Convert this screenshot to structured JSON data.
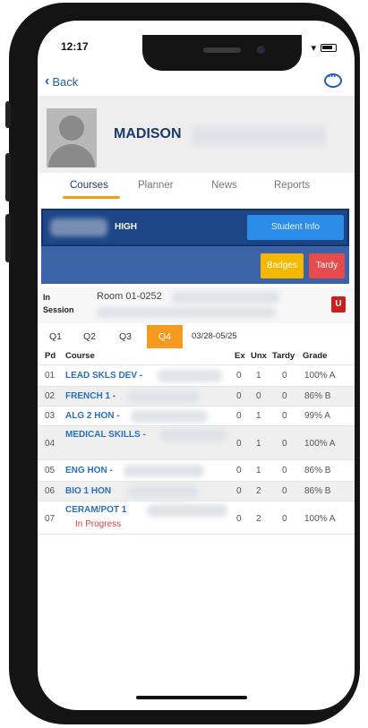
{
  "status_bar": {
    "time": "12:17",
    "wifi_icon": "wifi-icon",
    "battery_icon": "battery-icon"
  },
  "nav": {
    "back_label": "Back",
    "chat_icon": "chat-bubble-icon"
  },
  "profile": {
    "name": "MADISON"
  },
  "tabs": [
    {
      "label": "Courses",
      "active": true
    },
    {
      "label": "Planner",
      "active": false
    },
    {
      "label": "News",
      "active": false
    },
    {
      "label": "Reports",
      "active": false
    }
  ],
  "school": {
    "name": "HIGH",
    "student_info_label": "Student Info"
  },
  "actions": {
    "badges_label": "Badges",
    "tardy_label": "Tardy"
  },
  "session": {
    "status_label": "In Session",
    "room": "Room 01-0252",
    "badge": "U"
  },
  "quarters": {
    "items": [
      "Q1",
      "Q2",
      "Q3",
      "Q4"
    ],
    "active": "Q4",
    "date_range": "03/28-05/25"
  },
  "grades": {
    "headers": {
      "pd": "Pd",
      "course": "Course",
      "ex": "Ex",
      "unx": "Unx",
      "tardy": "Tardy",
      "grade": "Grade"
    },
    "rows": [
      {
        "pd": "01",
        "course": "LEAD SKLS DEV -",
        "ex": "0",
        "unx": "1",
        "tardy": "0",
        "grade": "100% A"
      },
      {
        "pd": "02",
        "course": "FRENCH 1 -",
        "ex": "0",
        "unx": "0",
        "tardy": "0",
        "grade": "86% B"
      },
      {
        "pd": "03",
        "course": "ALG 2 HON -",
        "ex": "0",
        "unx": "1",
        "tardy": "0",
        "grade": "99% A"
      },
      {
        "pd": "04",
        "course": "MEDICAL SKILLS -",
        "ex": "0",
        "unx": "1",
        "tardy": "0",
        "grade": "100% A"
      },
      {
        "pd": "05",
        "course": "ENG HON -",
        "ex": "0",
        "unx": "1",
        "tardy": "0",
        "grade": "86% B"
      },
      {
        "pd": "06",
        "course": "BIO 1 HON",
        "ex": "0",
        "unx": "2",
        "tardy": "0",
        "grade": "86% B"
      },
      {
        "pd": "07",
        "course": "CERAM/POT 1",
        "status": "In Progress",
        "ex": "0",
        "unx": "2",
        "tardy": "0",
        "grade": "100% A"
      }
    ]
  },
  "colors": {
    "accent": "#f39c12",
    "brand_dark": "#1d4687",
    "link": "#2a6fbf"
  }
}
